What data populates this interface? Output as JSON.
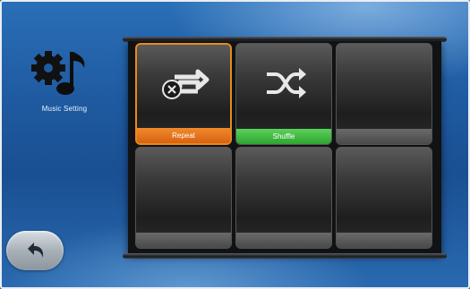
{
  "sidebar": {
    "icon": "gear-music-note-icon",
    "label": "Music Setting"
  },
  "grid": {
    "tiles": [
      {
        "label": "Repeat",
        "icon": "repeat-off-icon",
        "active": true,
        "strip_color": "#e0701c"
      },
      {
        "label": "Shuffle",
        "icon": "shuffle-icon",
        "active": false,
        "strip_color": "#3fbf3e"
      },
      {
        "label": "",
        "icon": "",
        "active": false
      },
      {
        "label": "",
        "icon": "",
        "active": false
      },
      {
        "label": "",
        "icon": "",
        "active": false
      },
      {
        "label": "",
        "icon": "",
        "active": false
      }
    ]
  },
  "controls": {
    "back_icon": "back-arrow-icon"
  },
  "colors": {
    "accent_orange": "#e88a1c",
    "accent_green": "#3fbf3e",
    "background": "#1f5aa0"
  }
}
